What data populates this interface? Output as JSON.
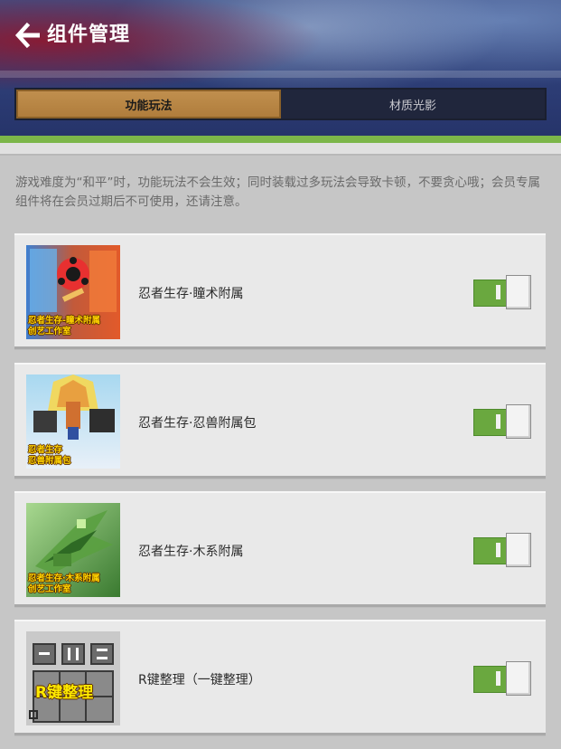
{
  "header": {
    "title": "组件管理",
    "back_icon": "arrow-left-icon"
  },
  "tabs": [
    {
      "label": "功能玩法",
      "active": true
    },
    {
      "label": "材质光影",
      "active": false
    }
  ],
  "notice": "游戏难度为“和平”时，功能玩法不会生效；同时装载过多玩法会导致卡顿，不要贪心哦；会员专属组件将在会员过期后不可使用，还请注意。",
  "items": [
    {
      "name": "忍者生存·瞳术附属",
      "caption": [
        "忍者生存-瞳术附属",
        "创艺工作室"
      ],
      "enabled": true
    },
    {
      "name": "忍者生存·忍兽附属包",
      "caption": [
        "忍者生存",
        "忍兽附属包"
      ],
      "enabled": true
    },
    {
      "name": "忍者生存·木系附属",
      "caption": [
        "忍者生存·木系附属",
        "创艺工作室"
      ],
      "enabled": true
    },
    {
      "name": "R键整理（一键整理）",
      "caption": [
        "R键整理"
      ],
      "enabled": true
    }
  ],
  "colors": {
    "tab_active": "#b88543",
    "toggle_on": "#6aa83f",
    "accent_strip": "#7cb649"
  }
}
